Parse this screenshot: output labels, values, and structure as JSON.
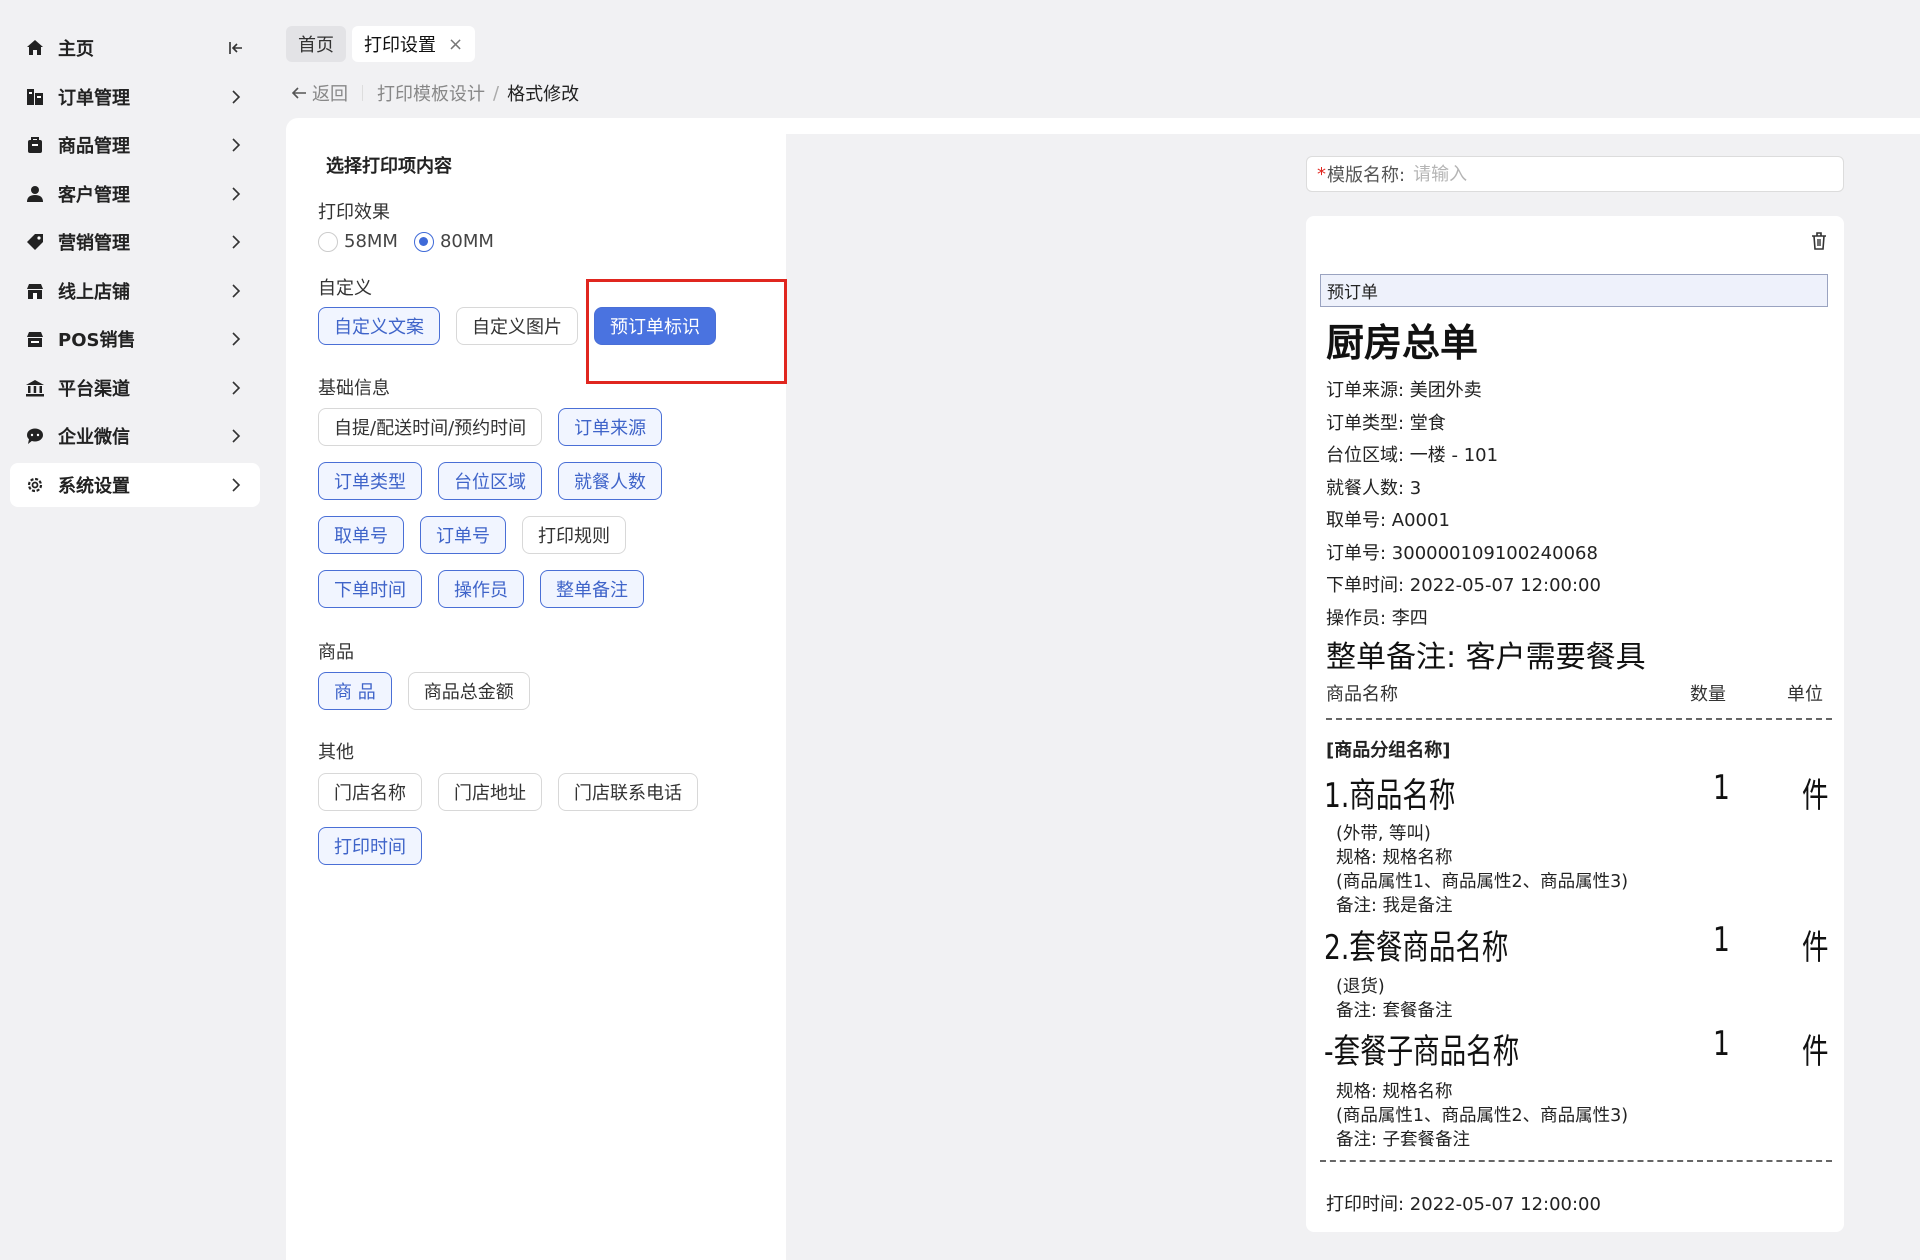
{
  "sidebar": {
    "items": [
      {
        "label": "主页",
        "icon": "home-icon"
      },
      {
        "label": "订单管理",
        "icon": "order-icon"
      },
      {
        "label": "商品管理",
        "icon": "product-icon"
      },
      {
        "label": "客户管理",
        "icon": "customer-icon"
      },
      {
        "label": "营销管理",
        "icon": "tag-icon"
      },
      {
        "label": "线上店铺",
        "icon": "store-icon"
      },
      {
        "label": "POS销售",
        "icon": "pos-icon"
      },
      {
        "label": "平台渠道",
        "icon": "bank-icon"
      },
      {
        "label": "企业微信",
        "icon": "chat-icon"
      },
      {
        "label": "系统设置",
        "icon": "gear-icon",
        "active": true
      }
    ]
  },
  "tabs": [
    {
      "label": "首页"
    },
    {
      "label": "打印设置",
      "active": true
    }
  ],
  "breadcrumb": {
    "back": "返回",
    "level1": "打印模板设计",
    "level2": "格式修改"
  },
  "panel": {
    "title": "选择打印项内容",
    "effect_label": "打印效果",
    "effect_options": [
      "58MM",
      "80MM"
    ],
    "effect_selected": "80MM",
    "custom_label": "自定义",
    "custom_chips": [
      "自定义文案",
      "自定义图片",
      "预订单标识"
    ],
    "basic_label": "基础信息",
    "basic_chips": [
      [
        "自提/配送时间/预约时间",
        "订单来源"
      ],
      [
        "订单类型",
        "台位区域",
        "就餐人数"
      ],
      [
        "取单号",
        "订单号",
        "打印规则"
      ],
      [
        "下单时间",
        "操作员",
        "整单备注"
      ]
    ],
    "goods_label": "商品",
    "goods_chips": [
      "商 品",
      "商品总金额"
    ],
    "other_label": "其他",
    "other_chips": [
      [
        "门店名称",
        "门店地址",
        "门店联系电话"
      ],
      [
        "打印时间"
      ]
    ]
  },
  "template_name": {
    "required_mark": "*",
    "label": "模版名称:",
    "placeholder": "请输入"
  },
  "receipt": {
    "tag": "预订单",
    "title": "厨房总单",
    "lines": [
      "订单来源: 美团外卖",
      "订单类型: 堂食",
      "台位区域: 一楼 - 101",
      "就餐人数: 3",
      "取单号: A0001",
      "订单号: 300000109100240068",
      "下单时间: 2022-05-07 12:00:00",
      "操作员: 李四"
    ],
    "note": "整单备注: 客户需要餐具",
    "columns": {
      "name": "商品名称",
      "qty": "数量",
      "unit": "单位"
    },
    "group": "[商品分组名称]",
    "items": [
      {
        "name": "1.商品名称",
        "qty": "1",
        "unit": "件",
        "subs": [
          "(外带, 等叫)",
          "规格: 规格名称",
          "(商品属性1、商品属性2、商品属性3)",
          "备注: 我是备注"
        ]
      },
      {
        "name": "2.套餐商品名称",
        "qty": "1",
        "unit": "件",
        "subs": [
          "(退货)",
          "备注: 套餐备注"
        ]
      },
      {
        "name": "-套餐子商品名称",
        "qty": "1",
        "unit": "件",
        "subs": [
          "规格: 规格名称",
          "(商品属性1、商品属性2、商品属性3)",
          "备注: 子套餐备注"
        ]
      }
    ],
    "print_time": "打印时间: 2022-05-07 12:00:00"
  },
  "colors": {
    "accent": "#4a73e0",
    "highlight_box": "#e0261f"
  }
}
